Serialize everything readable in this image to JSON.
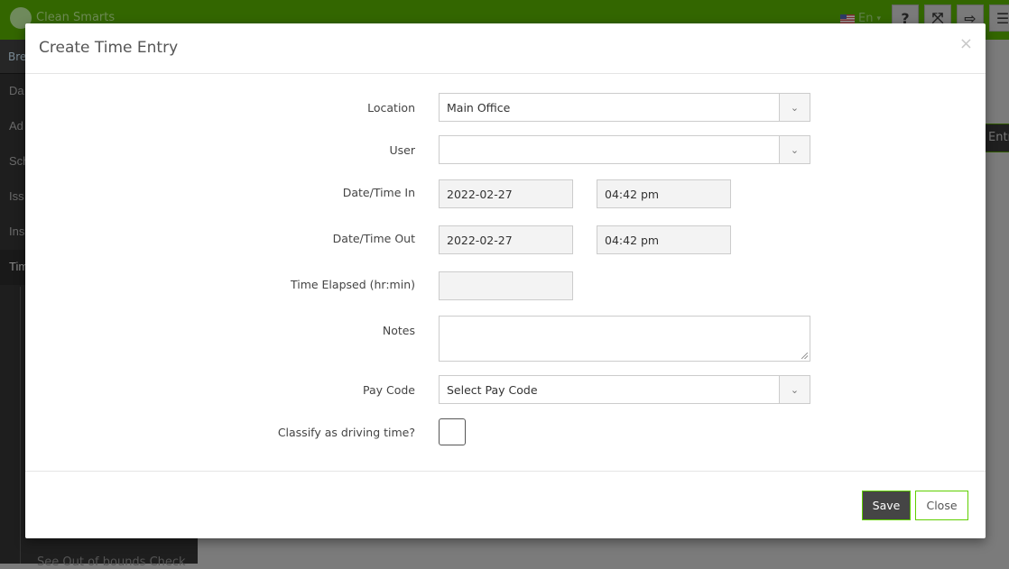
{
  "app": {
    "brand": "Clean Smarts",
    "language": "En"
  },
  "toolbar": {
    "help": "?",
    "fullscreen": "⤧",
    "logout": "⇨",
    "menu": "☰"
  },
  "sidebar": {
    "breadcrumb": "Bre",
    "items": [
      {
        "label": "Da"
      },
      {
        "label": "Ad"
      },
      {
        "label": "Sch"
      },
      {
        "label": "Iss"
      },
      {
        "label": "Ins"
      },
      {
        "label": "Tim"
      }
    ],
    "footer_item": "See Out of bounds Check"
  },
  "background": {
    "entry_button": "Entr"
  },
  "modal": {
    "title": "Create Time Entry",
    "close_x": "×",
    "fields": {
      "location": {
        "label": "Location",
        "value": "Main Office"
      },
      "user": {
        "label": "User",
        "value": ""
      },
      "datetime_in": {
        "label": "Date/Time In",
        "date": "2022-02-27",
        "time": "04:42 pm"
      },
      "datetime_out": {
        "label": "Date/Time Out",
        "date": "2022-02-27",
        "time": "04:42 pm"
      },
      "time_elapsed": {
        "label": "Time Elapsed (hr:min)",
        "value": ""
      },
      "notes": {
        "label": "Notes",
        "value": ""
      },
      "pay_code": {
        "label": "Pay Code",
        "value": "Select Pay Code"
      },
      "driving_time": {
        "label": "Classify as driving time?",
        "checked": false
      }
    },
    "buttons": {
      "save": "Save",
      "close": "Close"
    }
  },
  "colors": {
    "header": "#336600",
    "accent": "#5fcf00",
    "save_bg": "#454545"
  }
}
